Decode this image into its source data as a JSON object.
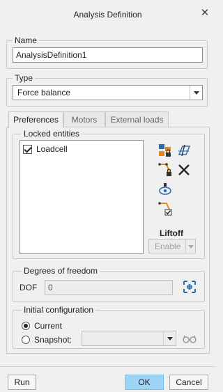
{
  "window": {
    "title": "Analysis Definition",
    "close_icon": "close-icon"
  },
  "name_group": {
    "label": "Name",
    "value": "AnalysisDefinition1"
  },
  "type_group": {
    "label": "Type",
    "selected": "Force balance"
  },
  "tabs": [
    {
      "label": "Preferences",
      "active": true
    },
    {
      "label": "Motors",
      "active": false
    },
    {
      "label": "External loads",
      "active": false
    }
  ],
  "locked_entities": {
    "label": "Locked entities",
    "items": [
      {
        "label": "Loadcell",
        "checked": true
      }
    ],
    "tools": [
      "lock-bodies-icon",
      "lock-planes-icon",
      "lock-joint-icon",
      "delete-icon",
      "lock-view-icon",
      "lock-connection-icon"
    ]
  },
  "liftoff": {
    "label": "Liftoff",
    "button": "Enable"
  },
  "dof_group": {
    "label": "Degrees of freedom",
    "field_label": "DOF",
    "value": "0"
  },
  "initial_config": {
    "label": "Initial configuration",
    "current": "Current",
    "snapshot": "Snapshot:",
    "selected": "current"
  },
  "footer": {
    "run": "Run",
    "ok": "OK",
    "cancel": "Cancel"
  },
  "colors": {
    "primary_button": "#9ed4f6",
    "tool_icon_blue": "#2b6cb0",
    "tool_icon_orange": "#e08a1e"
  }
}
